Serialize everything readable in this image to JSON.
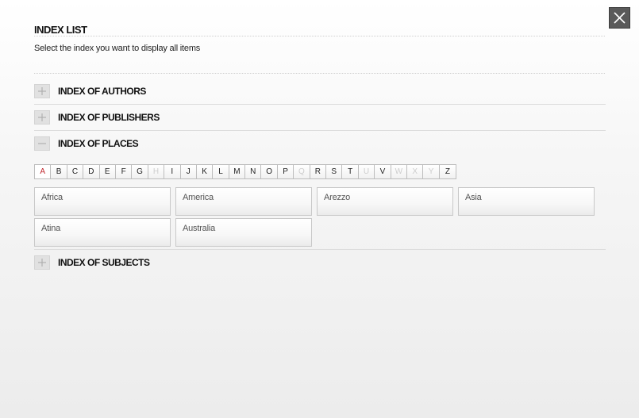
{
  "header": {
    "title": "INDEX LIST",
    "subtitle": "Select the index you want to display all items",
    "close_icon": "close-icon"
  },
  "sections": [
    {
      "label": "INDEX OF AUTHORS",
      "state": "collapsed",
      "icon": "plus-icon"
    },
    {
      "label": "INDEX OF PUBLISHERS",
      "state": "collapsed",
      "icon": "plus-icon"
    },
    {
      "label": "INDEX OF PLACES",
      "state": "expanded",
      "icon": "minus-icon"
    },
    {
      "label": "INDEX OF SUBJECTS",
      "state": "collapsed",
      "icon": "plus-icon"
    }
  ],
  "alphabet": {
    "letters": [
      "A",
      "B",
      "C",
      "D",
      "E",
      "F",
      "G",
      "H",
      "I",
      "J",
      "K",
      "L",
      "M",
      "N",
      "O",
      "P",
      "Q",
      "R",
      "S",
      "T",
      "U",
      "V",
      "W",
      "X",
      "Y",
      "Z"
    ],
    "selected": "A",
    "disabled": [
      "H",
      "Q",
      "U",
      "W",
      "X",
      "Y"
    ]
  },
  "places": [
    "Africa",
    "America",
    "Arezzo",
    "Asia",
    "Atina",
    "Australia"
  ],
  "colors": {
    "accent": "#c0282e",
    "close_bg": "#5a5a5a",
    "disabled_letter": "#cdcdcd"
  }
}
